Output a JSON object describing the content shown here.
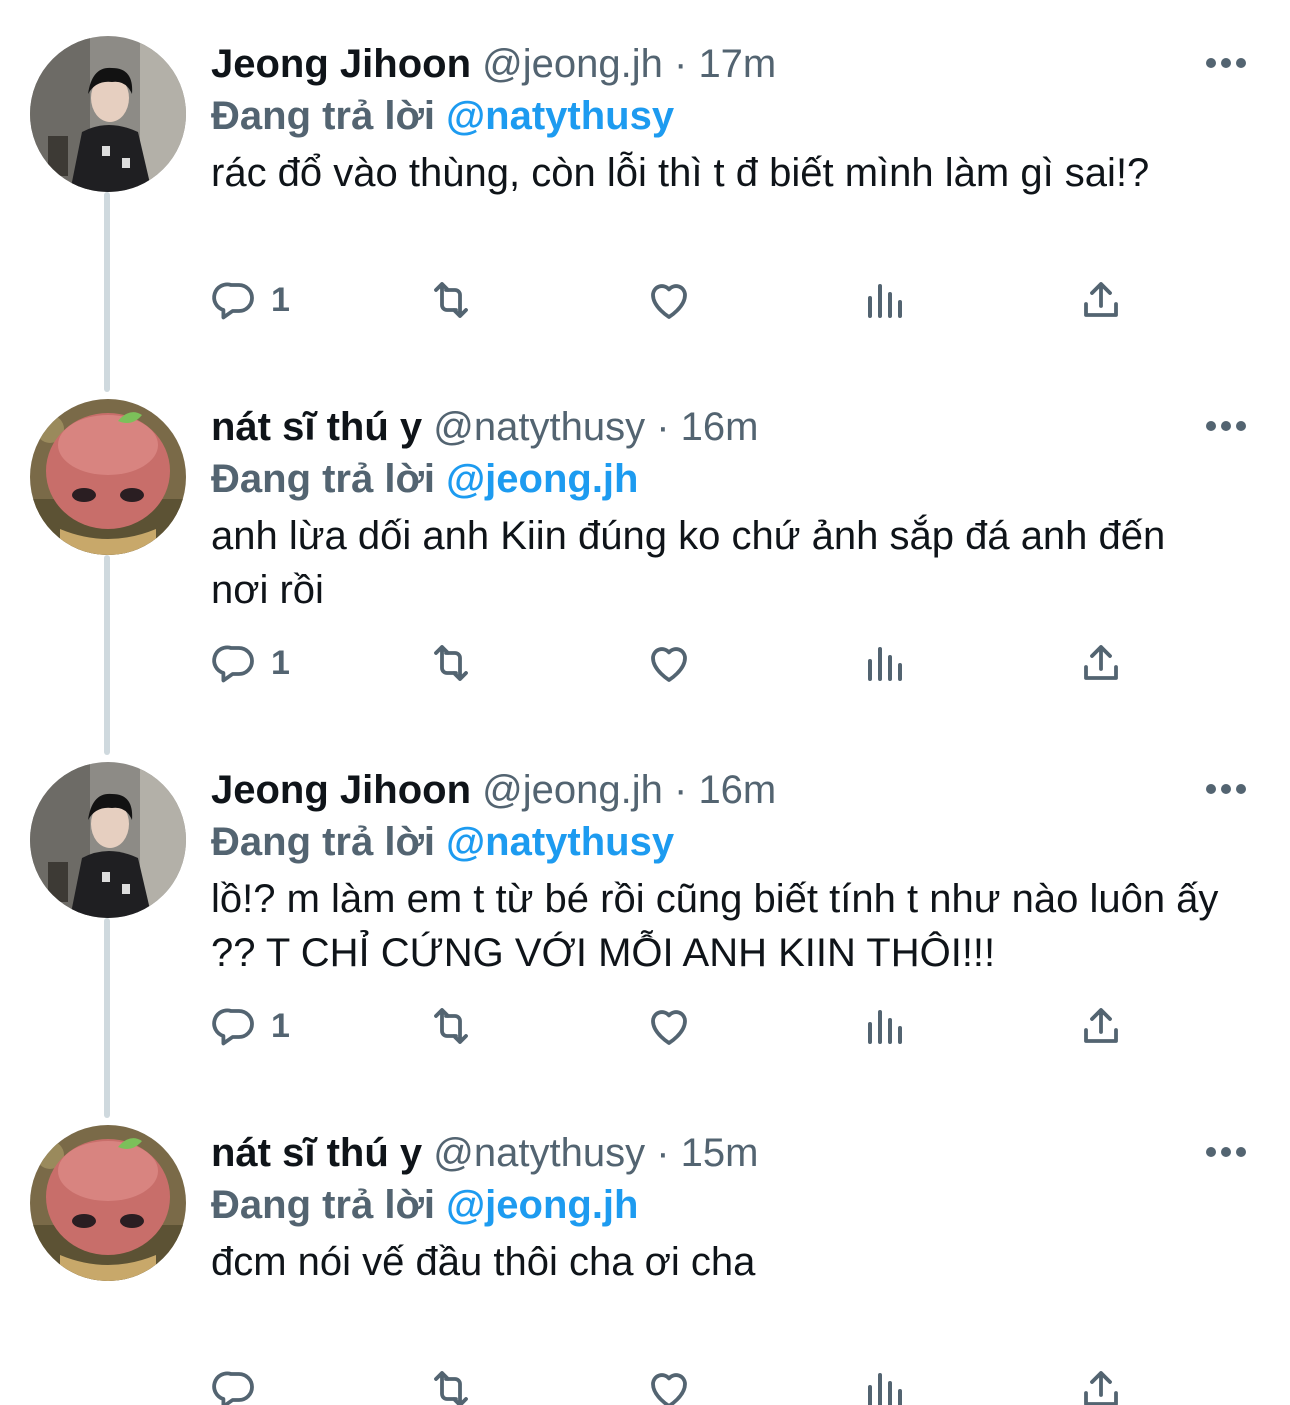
{
  "tweets": [
    {
      "display_name": "Jeong Jihoon",
      "handle": "@jeong.jh",
      "separator": "·",
      "time": "17m",
      "replying_label": "Đang trả lời",
      "replying_to": "@natythusy",
      "text": "rác đổ vào thùng, còn lỗi thì t đ biết mình làm gì sai!?",
      "reply_count": "1",
      "avatar": "photo-man-dark-jacket"
    },
    {
      "display_name": "nát sĩ thú y",
      "handle": "@natythusy",
      "separator": "·",
      "time": "16m",
      "replying_label": "Đang trả lời",
      "replying_to": "@jeong.jh",
      "text": "anh lừa dối anh Kiin đúng ko chứ ảnh sắp đá anh đến nơi rồi",
      "reply_count": "1",
      "avatar": "photo-pink-figurine"
    },
    {
      "display_name": "Jeong Jihoon",
      "handle": "@jeong.jh",
      "separator": "·",
      "time": "16m",
      "replying_label": "Đang trả lời",
      "replying_to": "@natythusy",
      "text": "lồ!? m làm em t từ bé rồi cũng biết tính t như nào luôn ấy ?? T CHỈ CỨNG VỚI MỖI ANH KIIN THÔI!!!",
      "reply_count": "1",
      "avatar": "photo-man-dark-jacket"
    },
    {
      "display_name": "nát sĩ thú y",
      "handle": "@natythusy",
      "separator": "·",
      "time": "15m",
      "replying_label": "Đang trả lời",
      "replying_to": "@jeong.jh",
      "text": "đcm nói vế đầu thôi cha ơi cha",
      "reply_count": "",
      "avatar": "photo-pink-figurine"
    }
  ],
  "icons": [
    "reply-icon",
    "retweet-icon",
    "like-icon",
    "analytics-icon",
    "share-icon",
    "more-icon"
  ],
  "colors": {
    "text": "#0f1419",
    "secondary": "#536471",
    "link": "#1d9bf0",
    "thread_line": "#cfd9de"
  }
}
